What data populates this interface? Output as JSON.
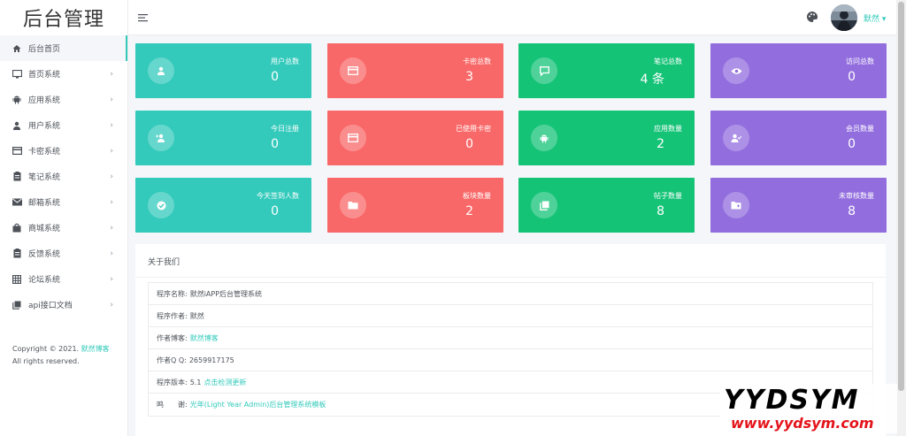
{
  "logo": "后台管理",
  "sidebar": {
    "items": [
      {
        "label": "后台首页",
        "icon": "home-icon"
      },
      {
        "label": "首页系统",
        "icon": "monitor-icon"
      },
      {
        "label": "应用系统",
        "icon": "android-icon"
      },
      {
        "label": "用户系统",
        "icon": "user-icon"
      },
      {
        "label": "卡密系统",
        "icon": "card-icon"
      },
      {
        "label": "笔记系统",
        "icon": "clipboard-icon"
      },
      {
        "label": "邮箱系统",
        "icon": "mail-icon"
      },
      {
        "label": "商城系统",
        "icon": "shopping-bag-icon"
      },
      {
        "label": "反馈系统",
        "icon": "clipboard-icon"
      },
      {
        "label": "论坛系统",
        "icon": "table-icon"
      },
      {
        "label": "api接口文档",
        "icon": "library-icon"
      }
    ],
    "copyright_prefix": "Copyright © 2021.",
    "copyright_link": "默然博客",
    "copyright_suffix": "All rights reserved."
  },
  "topbar": {
    "username": "默然",
    "menu_icon": "hamburger-icon",
    "theme_icon": "palette-icon"
  },
  "colors": {
    "teal": "#33cabb",
    "red": "#f96868",
    "green": "#15c377",
    "purple": "#926dde"
  },
  "cards": [
    {
      "title": "用户总数",
      "value": "0",
      "icon": "user-icon",
      "color": "teal"
    },
    {
      "title": "卡密总数",
      "value": "3",
      "icon": "card-icon",
      "color": "red"
    },
    {
      "title": "笔记总数",
      "value": "4 条",
      "icon": "comment-icon",
      "color": "green"
    },
    {
      "title": "访问总数",
      "value": "0",
      "icon": "eye-icon",
      "color": "purple"
    },
    {
      "title": "今日注册",
      "value": "0",
      "icon": "user-plus-icon",
      "color": "teal"
    },
    {
      "title": "已使用卡密",
      "value": "0",
      "icon": "card-icon",
      "color": "red"
    },
    {
      "title": "应用数量",
      "value": "2",
      "icon": "android-icon",
      "color": "green"
    },
    {
      "title": "会员数量",
      "value": "0",
      "icon": "user-check-icon",
      "color": "purple"
    },
    {
      "title": "今天签到人数",
      "value": "0",
      "icon": "check-circle-icon",
      "color": "teal"
    },
    {
      "title": "板块数量",
      "value": "2",
      "icon": "folder-icon",
      "color": "red"
    },
    {
      "title": "帖子数量",
      "value": "8",
      "icon": "library-icon",
      "color": "green"
    },
    {
      "title": "未审核数量",
      "value": "8",
      "icon": "folder-plus-icon",
      "color": "purple"
    }
  ],
  "about": {
    "title": "关于我们",
    "rows": [
      {
        "label": "程序名称:",
        "value": "默然iAPP后台管理系统",
        "link": ""
      },
      {
        "label": "程序作者:",
        "value": "默然",
        "link": ""
      },
      {
        "label": "作者博客:",
        "value": "",
        "link": "默然博客"
      },
      {
        "label": "作者Q Q:",
        "value": "2659917175",
        "link": ""
      },
      {
        "label": "程序版本:",
        "value": "5.1",
        "link": "点击检测更新"
      },
      {
        "label": "鸣　　谢:",
        "value": "",
        "link": "光年(Light Year Admin)后台管理系统模板"
      }
    ]
  },
  "watermark": {
    "line1": "YYDSYM",
    "line2": "www.yydsym.com"
  }
}
